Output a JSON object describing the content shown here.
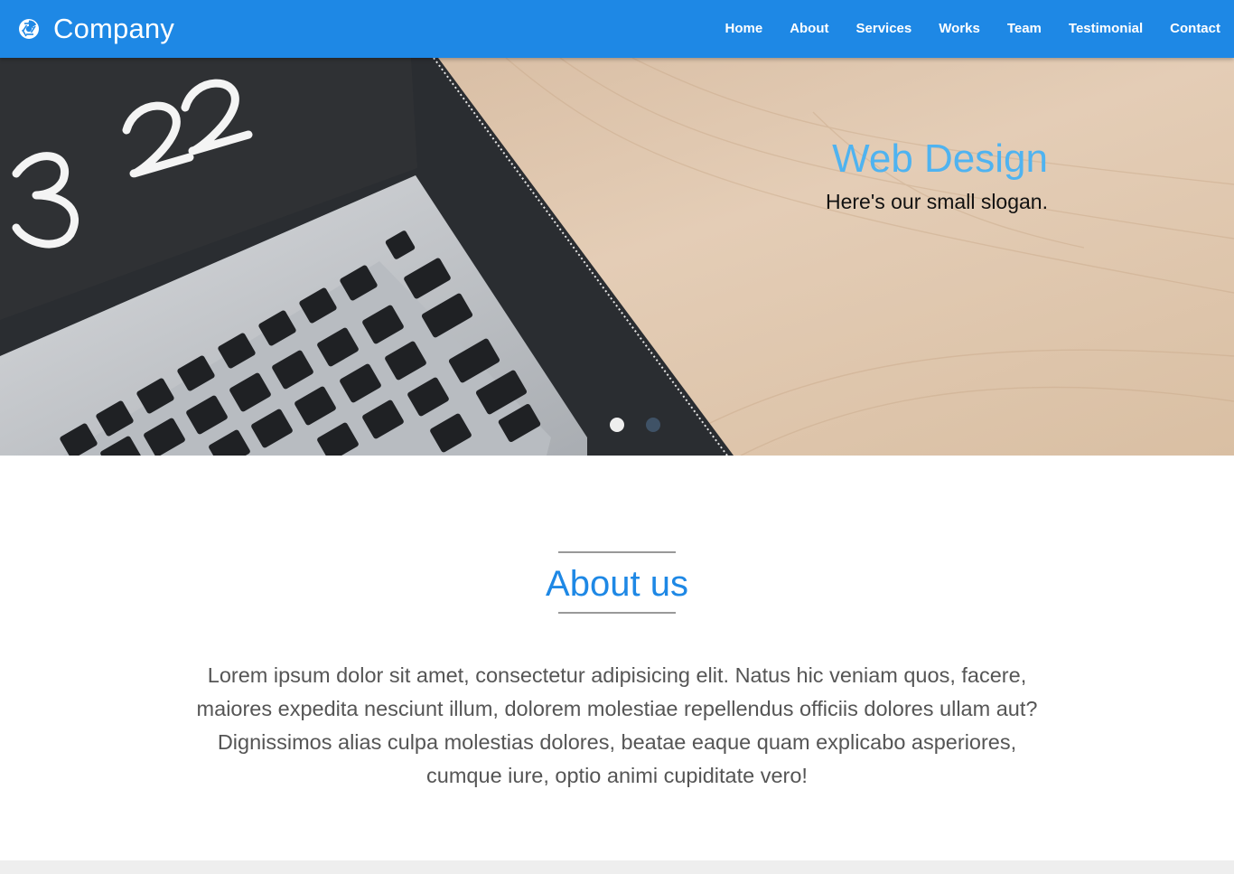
{
  "header": {
    "brand_name": "Company",
    "brand_icon": "aperture-icon",
    "nav": [
      {
        "label": "Home"
      },
      {
        "label": "About"
      },
      {
        "label": "Services"
      },
      {
        "label": "Works"
      },
      {
        "label": "Team"
      },
      {
        "label": "Testimonial"
      },
      {
        "label": "Contact"
      }
    ]
  },
  "hero": {
    "title": "Web Design",
    "slogan": "Here's our small slogan.",
    "slides": [
      {
        "state": "active"
      },
      {
        "state": "inactive"
      }
    ]
  },
  "about": {
    "title": "About us",
    "text": "Lorem ipsum dolor sit amet, consectetur adipisicing elit. Natus hic veniam quos, facere, maiores expedita nesciunt illum, dolorem molestiae repellendus officiis dolores ullam aut? Dignissimos alias culpa molestias dolores, beatae eaque quam explicabo asperiores, cumque iure, optio animi cupiditate vero!"
  },
  "colors": {
    "navbar": "#1e88e5",
    "hero_title": "#4fb3f0",
    "section_title": "#1e88e5",
    "body_text": "#555555"
  }
}
